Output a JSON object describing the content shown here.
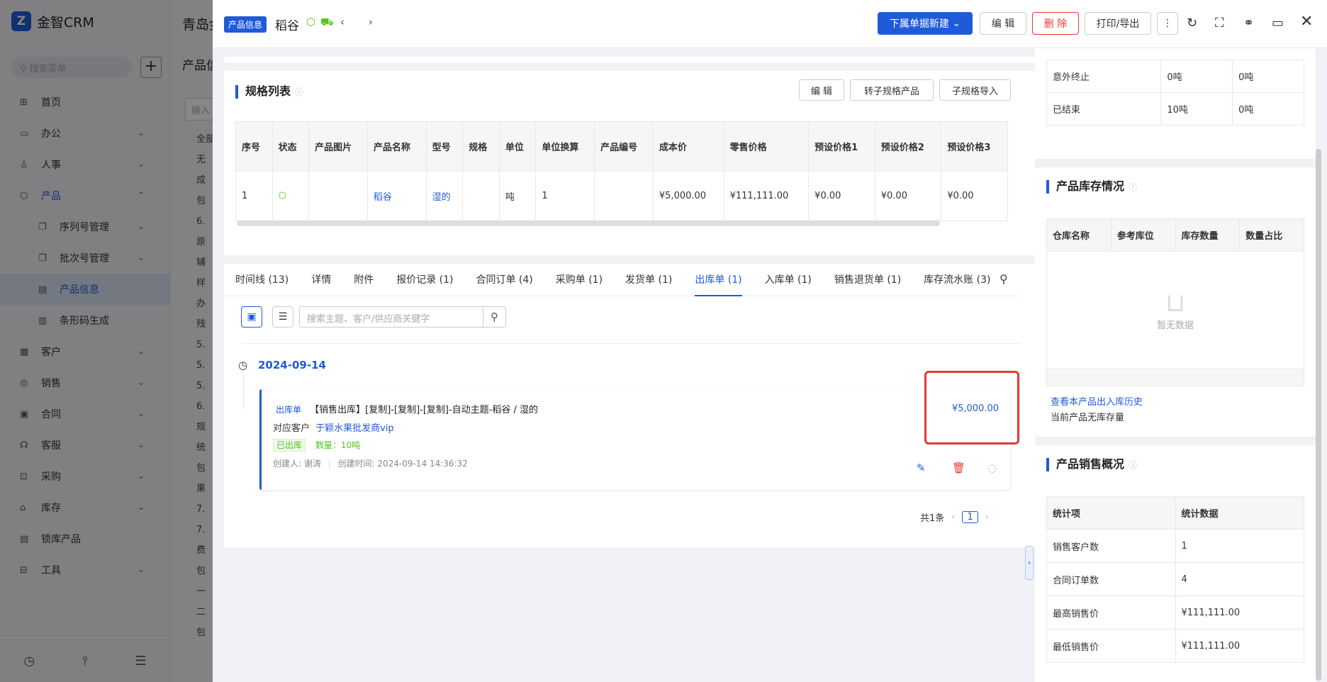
{
  "sidebar": {
    "brand": "金智CRM",
    "search_placeholder": "搜索菜单",
    "plus": "+",
    "items": [
      {
        "label": "首页",
        "icon": "⊞"
      },
      {
        "label": "办公",
        "icon": "▭",
        "chev": "⌄"
      },
      {
        "label": "人事",
        "icon": "♙",
        "chev": "⌄"
      },
      {
        "label": "产品",
        "icon": "⬡",
        "chev": "⌃"
      },
      {
        "label": "序列号管理",
        "icon": "❐",
        "chev": "⌄"
      },
      {
        "label": "批次号管理",
        "icon": "❐",
        "chev": "⌄"
      },
      {
        "label": "产品信息",
        "icon": "▤"
      },
      {
        "label": "条形码生成",
        "icon": "▥"
      },
      {
        "label": "客户",
        "icon": "▦",
        "chev": "⌄"
      },
      {
        "label": "销售",
        "icon": "◎",
        "chev": "⌄"
      },
      {
        "label": "合同",
        "icon": "▣",
        "chev": "⌄"
      },
      {
        "label": "客服",
        "icon": "☊",
        "chev": "⌄"
      },
      {
        "label": "采购",
        "icon": "⊡",
        "chev": "⌄"
      },
      {
        "label": "库存",
        "icon": "⌂",
        "chev": "⌄"
      },
      {
        "label": "锁库产品",
        "icon": "▤"
      },
      {
        "label": "工具",
        "icon": "⊟",
        "chev": "⌄"
      }
    ]
  },
  "middle": {
    "title": "青岛金",
    "subtitle": "产品信",
    "input_placeholder": "输入",
    "tree_items": [
      "全部",
      "无",
      "成",
      "包",
      "6.",
      "原",
      "辅",
      "样",
      "办",
      "残",
      "5.",
      "5.",
      "5.",
      "6.",
      "规",
      "统",
      "包",
      "果",
      "7.",
      "7.",
      "费",
      "包",
      "一",
      "二",
      "包"
    ]
  },
  "header": {
    "tag": "产品信息",
    "title": "稻谷",
    "buttons": {
      "new": "下属单据新建",
      "edit": "编 辑",
      "delete": "删 除",
      "print": "打印/导出"
    }
  },
  "spec": {
    "title": "规格列表",
    "buttons": [
      "编 辑",
      "转子规格产品",
      "子规格导入"
    ],
    "headers": [
      "序号",
      "状态",
      "产品图片",
      "产品名称",
      "型号",
      "规格",
      "单位",
      "单位换算",
      "产品编号",
      "成本价",
      "零售价格",
      "预设价格1",
      "预设价格2",
      "预设价格3"
    ],
    "row": [
      "1",
      "",
      "",
      "稻谷",
      "湿的",
      "",
      "吨",
      "1",
      "",
      "¥5,000.00",
      "¥111,111.00",
      "¥0.00",
      "¥0.00",
      "¥0.00"
    ]
  },
  "tabs": [
    "时间线 (13)",
    "详情",
    "附件",
    "报价记录 (1)",
    "合同订单 (4)",
    "采购单 (1)",
    "发货单 (1)",
    "出库单 (1)",
    "入库单 (1)",
    "销售退货单 (1)",
    "库存流水账 (3)"
  ],
  "active_tab": 7,
  "search_placeholder": "搜索主题、客户/供应商关键字",
  "timeline": {
    "date": "2024-09-14",
    "record": {
      "type": "出库单",
      "title": "【销售出库】[复制]-[复制]-[复制]-自动主题-稻谷 / 湿的",
      "amount": "¥5,000.00",
      "customer_label": "对应客户",
      "customer": "于颖水果批发商vip",
      "status": "已出库",
      "qty": "数量：10吨",
      "creator": "创建人: 谢涛",
      "created": "创建时间: 2024-09-14 14:36:32"
    }
  },
  "pager": {
    "total": "共1条",
    "page": "1",
    "prev": "‹",
    "next": "›"
  },
  "right": {
    "top_rows": [
      [
        "意外终止",
        "0吨",
        "0吨"
      ],
      [
        "已结束",
        "10吨",
        "0吨"
      ]
    ],
    "stock": {
      "title": "产品库存情况",
      "headers": [
        "仓库名称",
        "参考库位",
        "库存数量",
        "数量占比"
      ],
      "empty": "暂无数据",
      "history_link": "查看本产品出入库历史",
      "no_stock": "当前产品无库存量"
    },
    "sales": {
      "title": "产品销售概况",
      "headers": [
        "统计项",
        "统计数据"
      ],
      "rows": [
        [
          "销售客户数",
          "1"
        ],
        [
          "合同订单数",
          "4"
        ],
        [
          "最高销售价",
          "¥111,111.00"
        ],
        [
          "最低销售价",
          "¥111,111.00"
        ]
      ]
    }
  },
  "colors": {
    "primary": "#1f5bd8",
    "danger": "#e53935",
    "success": "#52c41a"
  }
}
